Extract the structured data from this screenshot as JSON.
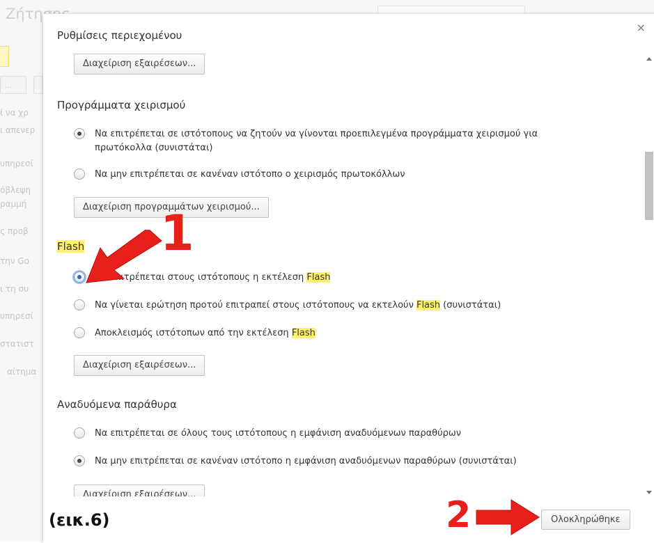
{
  "background": {
    "title": "Ζήτησης",
    "button_1": "...",
    "lines": [
      "ί να χρ",
      "ι απενερ",
      "υπηρεσί",
      "όβλεψη",
      "ραμμή",
      "ς προβ",
      "την Go",
      "ι τη συ",
      "υπηρεσί",
      "στατιστ",
      "αίτημα"
    ]
  },
  "dialog": {
    "title": "Ρυθμίσεις περιεχομένου",
    "close": "×",
    "sections": {
      "top_manage_button": "Διαχείριση εξαιρέσεων...",
      "handlers": {
        "title": "Προγράμματα χειρισμού",
        "options": [
          "Να επιτρέπεται σε ιστότοπους να ζητούν να γίνονται προεπιλεγμένα προγράμματα χειρισμού για πρωτόκολλα (συνιστάται)",
          "Να μην επιτρέπεται σε κανέναν ιστότοπο ο χειρισμός πρωτοκόλλων"
        ],
        "button": "Διαχείριση προγραμμάτων χειρισμού..."
      },
      "flash": {
        "title": "Flash",
        "option_1_prefix": "Να επιτρέπεται στους ιστότοπους η εκτέλεση ",
        "option_2_prefix": "Να γίνεται ερώτηση προτού επιτραπεί στους ιστότοπους να εκτελούν ",
        "option_2_suffix": " (συνιστάται)",
        "option_3_prefix": "Αποκλεισμός ιστότοπων από την εκτέλεση ",
        "keyword": "Flash",
        "button": "Διαχείριση εξαιρέσεων..."
      },
      "popups": {
        "title": "Αναδυόμενα παράθυρα",
        "options": [
          "Να επιτρέπεται σε όλους τους ιστότοπους η εμφάνιση αναδυόμενων παραθύρων",
          "Να μην επιτρέπεται σε κανέναν ιστότοπο η εμφάνιση αναδυόμενων παραθύρων (συνιστάται)"
        ],
        "button": "Διαχείριση εξαιρέσεων..."
      }
    },
    "done_button": "Ολοκληρώθηκε"
  },
  "annotations": {
    "step_1": "1",
    "step_2": "2",
    "figure_label": "(εικ.6)",
    "color": "#e8201b"
  },
  "selection": {
    "handlers": 0,
    "flash": 0,
    "popups": 1
  },
  "scroll_position": 0.32
}
